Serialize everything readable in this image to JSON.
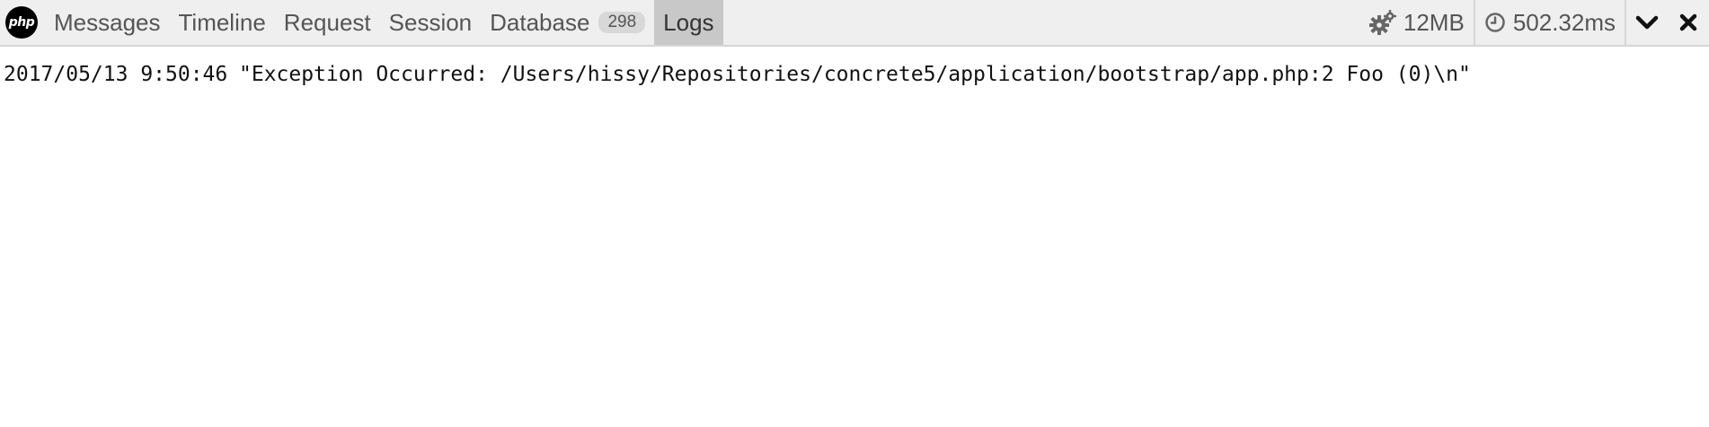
{
  "toolbar": {
    "brand_label": "php",
    "tabs": [
      {
        "label": "Messages"
      },
      {
        "label": "Timeline"
      },
      {
        "label": "Request"
      },
      {
        "label": "Session"
      },
      {
        "label": "Database",
        "badge": "298"
      },
      {
        "label": "Logs",
        "active": true
      }
    ],
    "memory": "12MB",
    "duration": "502.32ms",
    "icons": {
      "memory": "gears-icon",
      "duration": "clock-icon",
      "minimize": "chevron-down-icon",
      "close": "close-icon"
    }
  },
  "logs": [
    {
      "time": "2017/05/13 9:50:46",
      "message": "\"Exception Occurred: /Users/hissy/Repositories/concrete5/application/bootstrap/app.php:2 Foo (0)\\n\""
    }
  ]
}
